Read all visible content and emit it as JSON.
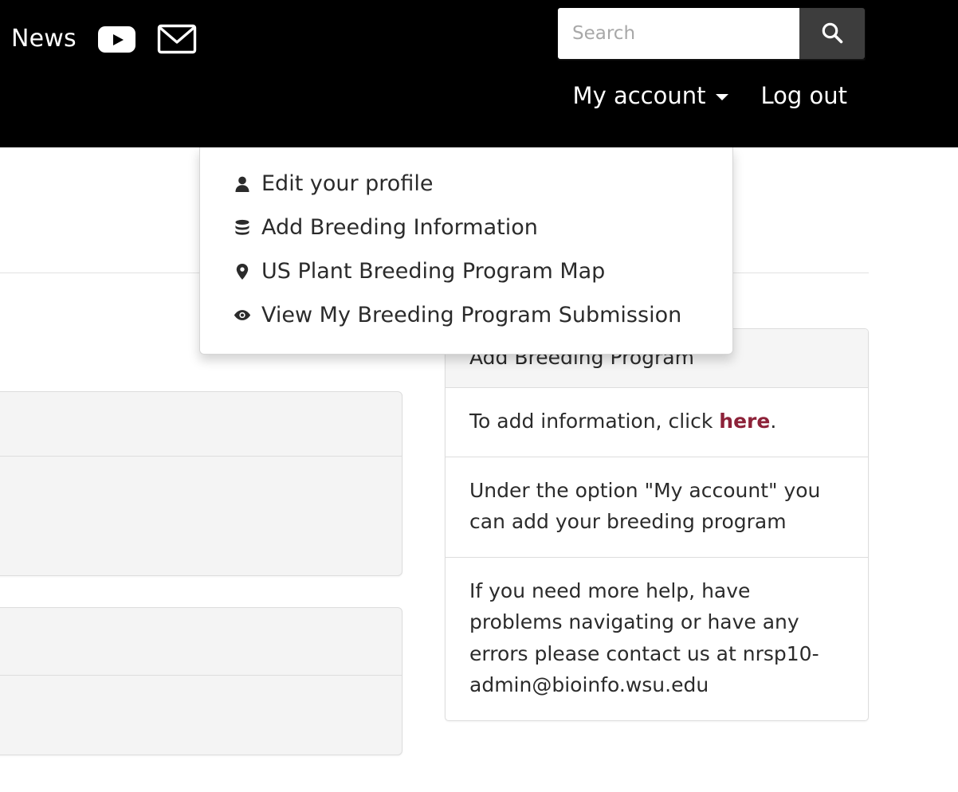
{
  "header": {
    "news_label": "News",
    "youtube_icon": "youtube-icon",
    "mail_icon": "envelope-icon",
    "search": {
      "placeholder": "Search",
      "value": "",
      "button_icon": "search-icon"
    },
    "account_menu_label": "My account",
    "account_caret_icon": "chevron-down-icon",
    "logout_label": "Log out"
  },
  "account_dropdown": {
    "items": [
      {
        "icon": "user-icon",
        "label": "Edit your profile"
      },
      {
        "icon": "database-icon",
        "label": "Add Breeding Information"
      },
      {
        "icon": "map-pin-icon",
        "label": "US Plant Breeding Program Map"
      },
      {
        "icon": "eye-icon",
        "label": "View My Breeding Program Submission"
      }
    ]
  },
  "right_panel": {
    "title": "Add Breeding Program",
    "row_click_prefix": "To add information, click ",
    "row_click_link": "here",
    "row_click_suffix": ".",
    "row_option": "Under the option \"My account\" you can add your breeding program",
    "row_help": "If you need more help, have problems navigating or have any errors please contact us at nrsp10-admin@bioinfo.wsu.edu"
  },
  "colors": {
    "header_background": "#000000",
    "link_accent": "#8d2239",
    "panel_header_background": "#f5f5f5",
    "panel_border": "#dddddd",
    "left_panel_background": "#f4f4f4",
    "search_button_background": "#3d3d3d"
  }
}
